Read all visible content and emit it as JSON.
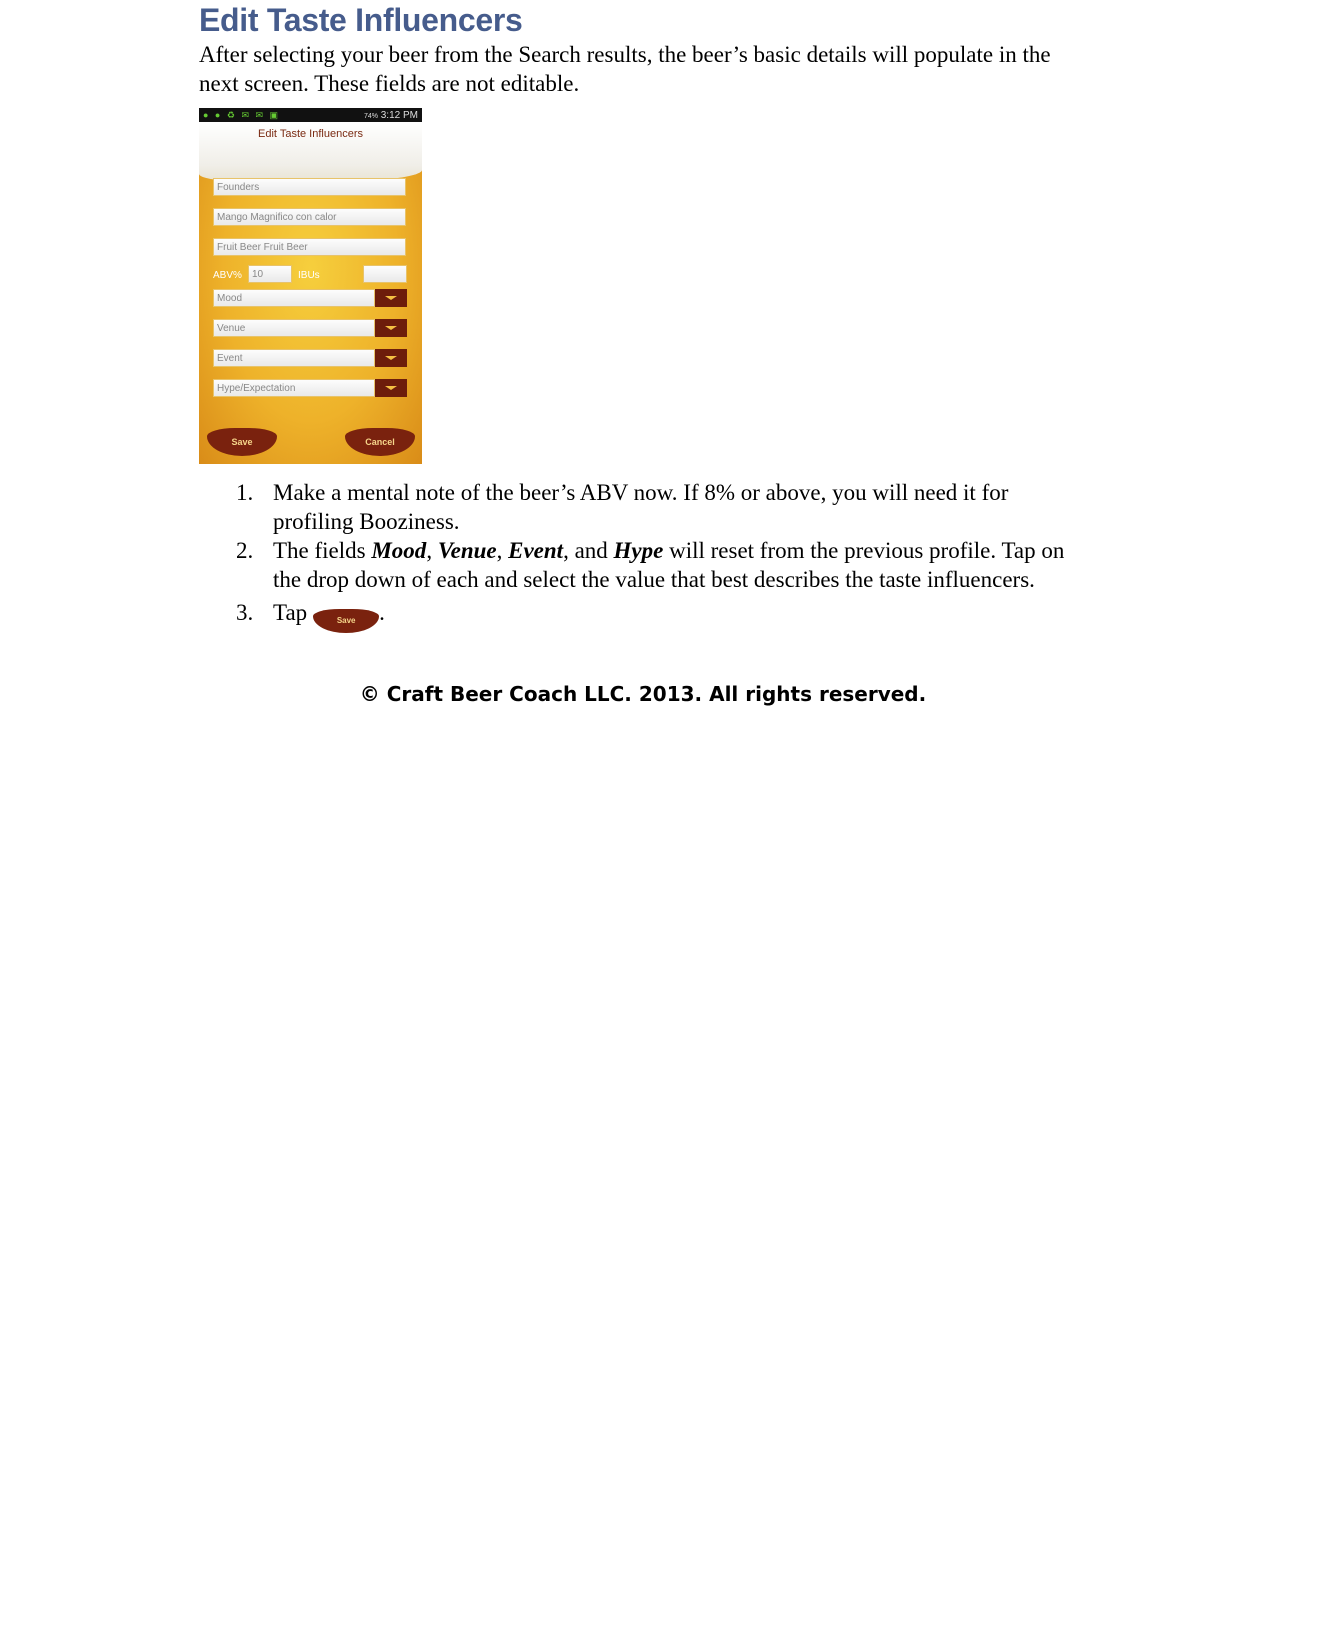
{
  "title": "Edit Taste Influencers",
  "intro": "After selecting your beer from the Search results, the beer’s basic details will populate in the next screen. These fields are not editable.",
  "phone": {
    "status_time": "3:12 PM",
    "battery": "74%",
    "screen_title": "Edit Taste Influencers",
    "brewery": "Founders",
    "beer_name": "Mango Magnifico con calor",
    "style": "Fruit Beer Fruit Beer",
    "abv_label": "ABV%",
    "abv_value": "10",
    "ibus_label": "IBUs",
    "ibus_value": "",
    "dropdowns": [
      "Mood",
      "Venue",
      "Event",
      "Hype/Expectation"
    ],
    "save_label": "Save",
    "cancel_label": "Cancel",
    "accent": "#6d1d0b",
    "background": "#eeb22a"
  },
  "steps": [
    {
      "num": "1.",
      "text": "Make a mental note of the beer’s ABV now. If 8% or above, you will need it for profiling Booziness."
    },
    {
      "num": "2.",
      "pre": "The fields ",
      "mood": "Mood",
      "c1": ", ",
      "venue": "Venue",
      "c2": ", ",
      "event": "Event",
      "c3": ", and ",
      "hype": "Hype",
      "post": " will reset from the previous profile. Tap on the drop down of each and select the value that best describes the taste influencers."
    },
    {
      "num": "3.",
      "pre": "Tap",
      "button": "Save",
      "post": "."
    }
  ],
  "footer": "© Craft Beer Coach LLC. 2013. All rights reserved.",
  "title_color": "#465c8c"
}
